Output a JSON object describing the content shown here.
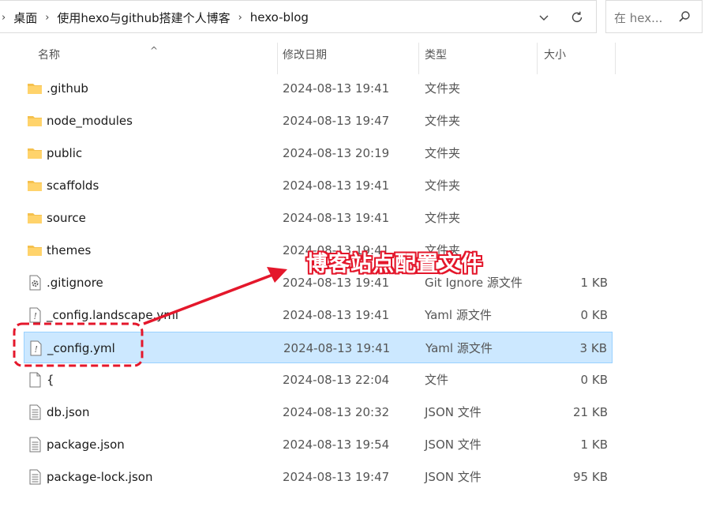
{
  "address": {
    "crumbs": [
      "桌面",
      "使用hexo与github搭建个人博客",
      "hexo-blog"
    ],
    "search_placeholder": "在 hex..."
  },
  "columns": {
    "name": "名称",
    "date": "修改日期",
    "type": "类型",
    "size": "大小"
  },
  "files": [
    {
      "name": ".github",
      "date": "2024-08-13  19:41",
      "type": "文件夹",
      "size": "",
      "icon": "folder-icon"
    },
    {
      "name": "node_modules",
      "date": "2024-08-13  19:47",
      "type": "文件夹",
      "size": "",
      "icon": "folder-icon"
    },
    {
      "name": "public",
      "date": "2024-08-13  20:19",
      "type": "文件夹",
      "size": "",
      "icon": "folder-icon"
    },
    {
      "name": "scaffolds",
      "date": "2024-08-13  19:41",
      "type": "文件夹",
      "size": "",
      "icon": "folder-icon"
    },
    {
      "name": "source",
      "date": "2024-08-13  19:41",
      "type": "文件夹",
      "size": "",
      "icon": "folder-icon"
    },
    {
      "name": "themes",
      "date": "2024-08-13  19:41",
      "type": "文件夹",
      "size": "",
      "icon": "folder-icon"
    },
    {
      "name": ".gitignore",
      "date": "2024-08-13  19:41",
      "type": "Git Ignore 源文件",
      "size": "1 KB",
      "icon": "gear-file-icon"
    },
    {
      "name": "_config.landscape.yml",
      "date": "2024-08-13  19:41",
      "type": "Yaml 源文件",
      "size": "0 KB",
      "icon": "yaml-file-icon"
    },
    {
      "name": "_config.yml",
      "date": "2024-08-13  19:41",
      "type": "Yaml 源文件",
      "size": "3 KB",
      "icon": "yaml-file-icon"
    },
    {
      "name": "{",
      "date": "2024-08-13  22:04",
      "type": "文件",
      "size": "0 KB",
      "icon": "blank-file-icon"
    },
    {
      "name": "db.json",
      "date": "2024-08-13  20:32",
      "type": "JSON 文件",
      "size": "21 KB",
      "icon": "text-file-icon"
    },
    {
      "name": "package.json",
      "date": "2024-08-13  19:54",
      "type": "JSON 文件",
      "size": "1 KB",
      "icon": "text-file-icon"
    },
    {
      "name": "package-lock.json",
      "date": "2024-08-13  19:47",
      "type": "JSON 文件",
      "size": "95 KB",
      "icon": "text-file-icon"
    }
  ],
  "annotation": {
    "text": "博客站点配置文件"
  },
  "colors": {
    "selection": "#cce8ff",
    "annotation_red": "#e4172b",
    "folder": "#f5c14e"
  }
}
